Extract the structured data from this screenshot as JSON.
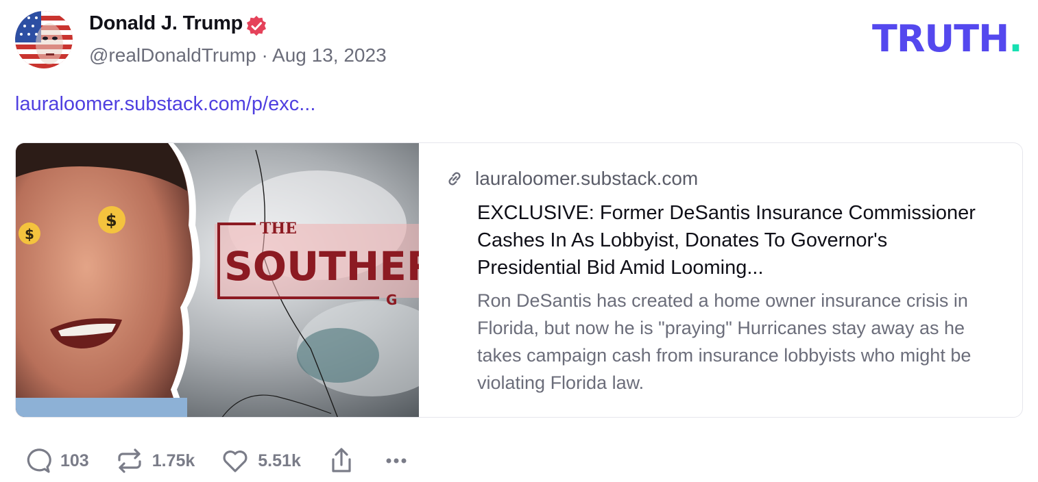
{
  "author": {
    "display_name": "Donald J. Trump",
    "handle": "@realDonaldTrump",
    "separator": "·",
    "date": "Aug 13, 2023",
    "verified": true
  },
  "brand": {
    "logo_text": "TRUTH",
    "logo_dot": ".",
    "colors": {
      "primary": "#5448EE",
      "accent": "#17E0B2"
    }
  },
  "post": {
    "link_text": "lauraloomer.substack.com/p/exc..."
  },
  "link_card": {
    "domain": "lauraloomer.substack.com",
    "title": "EXCLUSIVE: Former DeSantis Insurance Commissioner Cashes In As Lobbyist, Donates To Governor's Presidential Bid Amid Looming...",
    "description": "Ron DeSantis has created a home owner insurance crisis in Florida, but now he is \"praying\" Hurricanes stay away as he takes campaign cash from insurance lobbyists who might be violating Florida law.",
    "thumbnail_text": {
      "line1": "THE",
      "line2": "SOUTHER",
      "line3": "G"
    }
  },
  "actions": {
    "replies": "103",
    "retruths": "1.75k",
    "likes": "5.51k"
  }
}
